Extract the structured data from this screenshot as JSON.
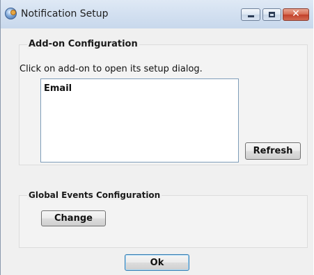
{
  "window": {
    "title": "Notification Setup",
    "controls": {
      "minimize": "minimize",
      "maximize": "maximize",
      "close": "✕"
    }
  },
  "addon_config": {
    "label": "Add-on Configuration",
    "instruction": "Click on add-on to open its setup dialog.",
    "items": [
      "Email"
    ],
    "refresh_label": "Refresh"
  },
  "global_events": {
    "label": "Global Events Configuration",
    "change_label": "Change"
  },
  "ok_label": "Ok",
  "icons": {
    "app": "notification-setup-app-icon",
    "minimize": "minimize-icon",
    "maximize": "maximize-icon",
    "close": "close-icon"
  },
  "colors": {
    "titlebar": "#d4e1f1",
    "close_button": "#c2402a",
    "dialog_bg": "#f0f0f0",
    "list_border": "#7f9db9",
    "default_button_border": "#3c7fb1"
  }
}
